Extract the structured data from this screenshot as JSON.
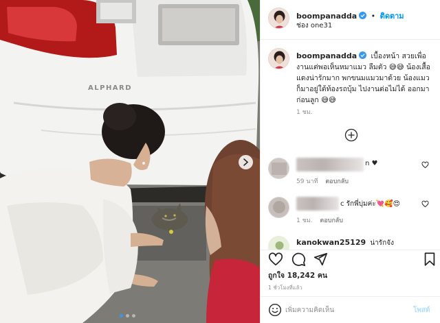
{
  "media": {
    "car_badge": "ALPHARD",
    "active_slide": 1,
    "slide_count": 3
  },
  "header": {
    "username": "boompanadda",
    "separator": "•",
    "follow_label": "ติดตาม",
    "location": "ช่อง one31"
  },
  "caption": {
    "username": "boompanadda",
    "text": "เบื้องหน้า สวยเพื่องานแต่พอเห็นหมาแมว ลืมตัว 😅😅 น้องเสื้อแดงน่ารักมาก พกขนมแมวมาด้วย น้องแมวก็มาอยู่ใต้ท้องรถบุ้ม ไปงานต่อไม่ได้ ออกมาก่อนลูก 😅😅",
    "time": "1 ชม."
  },
  "comments": [
    {
      "visible_text": "n ♥",
      "time": "59 นาที",
      "reply_label": "ตอบกลับ"
    },
    {
      "visible_text": "c รักพี่บุ่มค่ะ💘🥰😍",
      "time": "1 ชม.",
      "reply_label": "ตอบกลับ"
    },
    {
      "username": "kanokwan25129",
      "visible_text": "น่ารักจัง"
    }
  ],
  "actions": {
    "likes_label": "ถูกใจ 18,242 คน",
    "post_time": "1 ชั่วโมงที่แล้ว"
  },
  "add_comment": {
    "placeholder": "เพิ่มความคิดเห็น",
    "post_label": "โพสต์"
  },
  "colors": {
    "accent": "#0095f6",
    "verified": "#3897f0",
    "muted_text": "#8e8e8e",
    "car_taillight": "#c01f1f",
    "cardigan": "#c8263a"
  }
}
